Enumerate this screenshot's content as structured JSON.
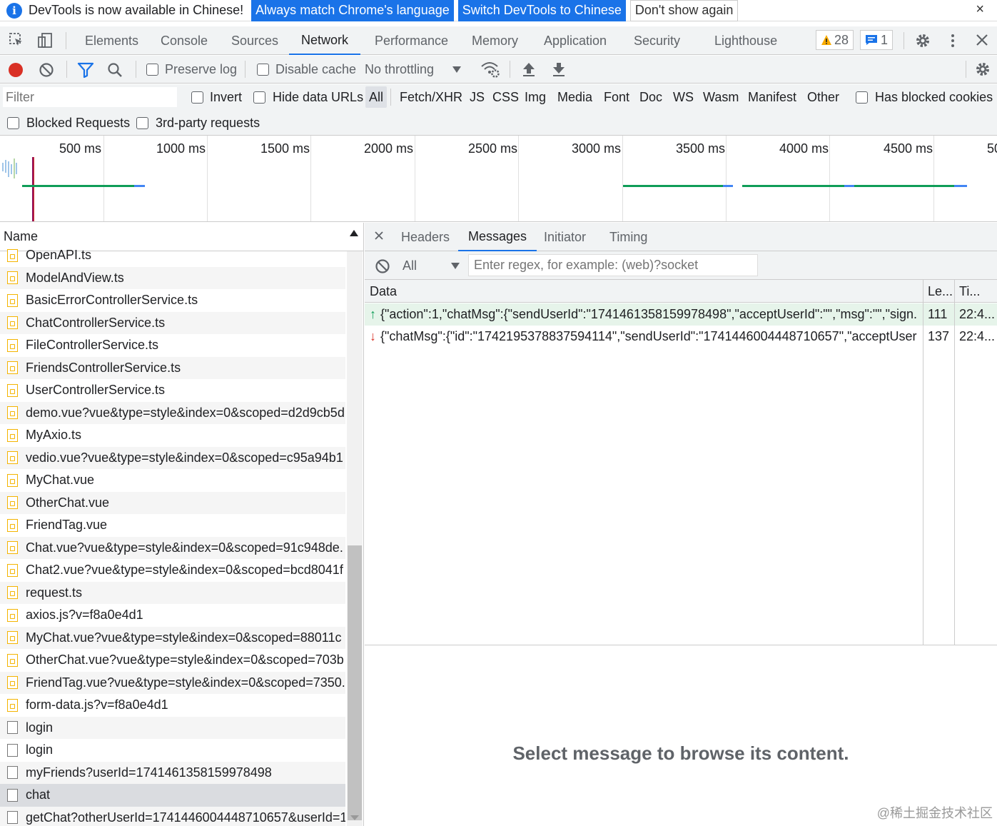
{
  "infobar": {
    "message": "DevTools is now available in Chinese!",
    "btn_match": "Always match Chrome's language",
    "btn_switch": "Switch DevTools to Chinese",
    "btn_dont_show": "Don't show again",
    "close": "×",
    "info_glyph": "i"
  },
  "main_tabs": [
    "Elements",
    "Console",
    "Sources",
    "Network",
    "Performance",
    "Memory",
    "Application",
    "Security",
    "Lighthouse"
  ],
  "active_tab": "Network",
  "badges": {
    "warnings": "28",
    "messages": "1"
  },
  "toolbar": {
    "preserve_log": "Preserve log",
    "disable_cache": "Disable cache",
    "throttling": "No throttling"
  },
  "filter": {
    "placeholder": "Filter",
    "invert": "Invert",
    "hide_data_urls": "Hide data URLs",
    "types": [
      "All",
      "Fetch/XHR",
      "JS",
      "CSS",
      "Img",
      "Media",
      "Font",
      "Doc",
      "WS",
      "Wasm",
      "Manifest",
      "Other"
    ],
    "has_blocked_cookies": "Has blocked cookies",
    "blocked_requests": "Blocked Requests",
    "third_party": "3rd-party requests"
  },
  "overview": {
    "ticks": [
      "500 ms",
      "1000 ms",
      "1500 ms",
      "2000 ms",
      "2500 ms",
      "3000 ms",
      "3500 ms",
      "4000 ms",
      "4500 ms",
      "50"
    ]
  },
  "requests": {
    "header": "Name",
    "items": [
      {
        "name": "OpenAPI.ts",
        "kind": "file"
      },
      {
        "name": "ModelAndView.ts",
        "kind": "file"
      },
      {
        "name": "BasicErrorControllerService.ts",
        "kind": "file"
      },
      {
        "name": "ChatControllerService.ts",
        "kind": "file"
      },
      {
        "name": "FileControllerService.ts",
        "kind": "file"
      },
      {
        "name": "FriendsControllerService.ts",
        "kind": "file"
      },
      {
        "name": "UserControllerService.ts",
        "kind": "file"
      },
      {
        "name": "demo.vue?vue&type=style&index=0&scoped=d2d9cb5d",
        "kind": "file"
      },
      {
        "name": "MyAxio.ts",
        "kind": "file"
      },
      {
        "name": "vedio.vue?vue&type=style&index=0&scoped=c95a94b1",
        "kind": "file"
      },
      {
        "name": "MyChat.vue",
        "kind": "file"
      },
      {
        "name": "OtherChat.vue",
        "kind": "file"
      },
      {
        "name": "FriendTag.vue",
        "kind": "file"
      },
      {
        "name": "Chat.vue?vue&type=style&index=0&scoped=91c948de.",
        "kind": "file"
      },
      {
        "name": "Chat2.vue?vue&type=style&index=0&scoped=bcd8041f",
        "kind": "file"
      },
      {
        "name": "request.ts",
        "kind": "file"
      },
      {
        "name": "axios.js?v=f8a0e4d1",
        "kind": "file"
      },
      {
        "name": "MyChat.vue?vue&type=style&index=0&scoped=88011c",
        "kind": "file"
      },
      {
        "name": "OtherChat.vue?vue&type=style&index=0&scoped=703b",
        "kind": "file"
      },
      {
        "name": "FriendTag.vue?vue&type=style&index=0&scoped=7350.",
        "kind": "file"
      },
      {
        "name": "form-data.js?v=f8a0e4d1",
        "kind": "file"
      },
      {
        "name": "login",
        "kind": "doc"
      },
      {
        "name": "login",
        "kind": "doc"
      },
      {
        "name": "myFriends?userId=1741461358159978498",
        "kind": "doc"
      },
      {
        "name": "chat",
        "kind": "doc",
        "selected": true
      },
      {
        "name": "getChat?otherUserId=1741446004448710657&userId=1",
        "kind": "doc"
      }
    ]
  },
  "detail_tabs": [
    "Headers",
    "Messages",
    "Initiator",
    "Timing"
  ],
  "detail_active": "Messages",
  "messages": {
    "filter_all": "All",
    "regex_placeholder": "Enter regex, for example: (web)?socket",
    "columns": {
      "data": "Data",
      "length": "Le...",
      "time": "Ti..."
    },
    "rows": [
      {
        "dir": "sent",
        "arrow": "↑",
        "data": "{\"action\":1,\"chatMsg\":{\"sendUserId\":\"1741461358159978498\",\"acceptUserId\":\"\",\"msg\":\"\",\"sign...",
        "length": "111",
        "time": "22:4..."
      },
      {
        "dir": "received",
        "arrow": "↓",
        "data": "{\"chatMsg\":{\"id\":\"1742195378837594114\",\"sendUserId\":\"1741446004448710657\",\"acceptUser...",
        "length": "137",
        "time": "22:4..."
      }
    ],
    "placeholder": "Select message to browse its content."
  },
  "watermark": "@稀土掘金技术社区",
  "colors": {
    "accent": "#1a73e8",
    "record": "#d93025",
    "sent_row": "#e6f4ea",
    "file_icon": "#f4b400",
    "waterfall_green": "#0f9d58",
    "waterfall_blue": "#4285f4"
  }
}
